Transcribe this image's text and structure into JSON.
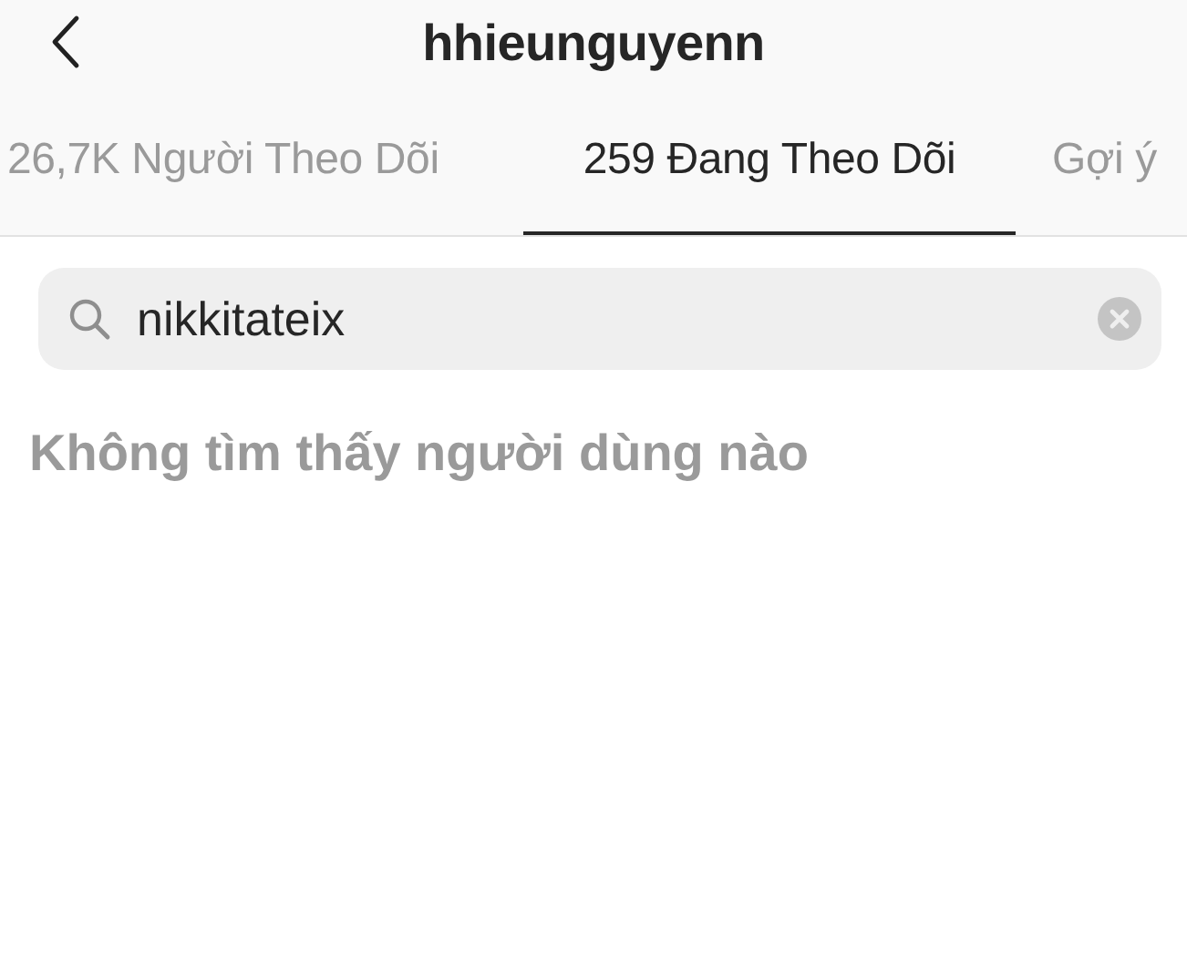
{
  "header": {
    "title": "hhieunguyenn"
  },
  "tabs": [
    {
      "label": "26,7K Người Theo Dõi",
      "selected": false
    },
    {
      "label": "259 Đang Theo Dõi",
      "selected": true
    },
    {
      "label": "Gợi ý",
      "selected": false
    }
  ],
  "search": {
    "value": "nikkitateix"
  },
  "message": "Không tìm thấy người dùng nào"
}
